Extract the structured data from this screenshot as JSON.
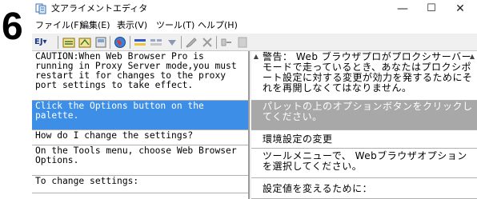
{
  "step_number": "6",
  "window": {
    "title": "文アライメントエディタ"
  },
  "window_controls": {
    "minimize": "—",
    "maximize": "☐",
    "close": "✕"
  },
  "menu": [
    {
      "label": "ファイル(F)"
    },
    {
      "label": "編集(E)"
    },
    {
      "label": "表示(V)"
    },
    {
      "label": "ツール(T)"
    },
    {
      "label": "ヘルプ(H)"
    }
  ],
  "toolbar": {
    "dropdown_label": "EJ▾",
    "icons": [
      "align-icon",
      "align-icon",
      "document-icon",
      "globe-icon",
      "merge-icon",
      "split-icon",
      "down-arrow-icon",
      "edit-icon",
      "delete-icon",
      "insert-icon",
      "blank-icon"
    ]
  },
  "segments": [
    {
      "source": "CAUTION:When Web Browser Pro is running in Proxy Server mode,you must restart it for changes to the proxy port settings to take effect.",
      "target": "警告： Web ブラウザプロがプロクシサーバーモードで走っているとき、あなたはプロクシポート設定に対する変更が効力を発するためにそれを再開しなくてはなりません。",
      "selected": false
    },
    {
      "source": "Click the Options button on the palette.",
      "target": "パレットの上のオプションボタンをクリックしてください。",
      "selected": true
    },
    {
      "source": "How do I change the settings?",
      "target": "環境設定の変更",
      "selected": false
    },
    {
      "source": "On the Tools menu, choose Web Browser Options.",
      "target": "ツールメニューで、 Webブラウザオプションを選択してください。",
      "selected": false
    },
    {
      "source": "To change settings:",
      "target": "設定値を変えるために：",
      "selected": false
    }
  ]
}
